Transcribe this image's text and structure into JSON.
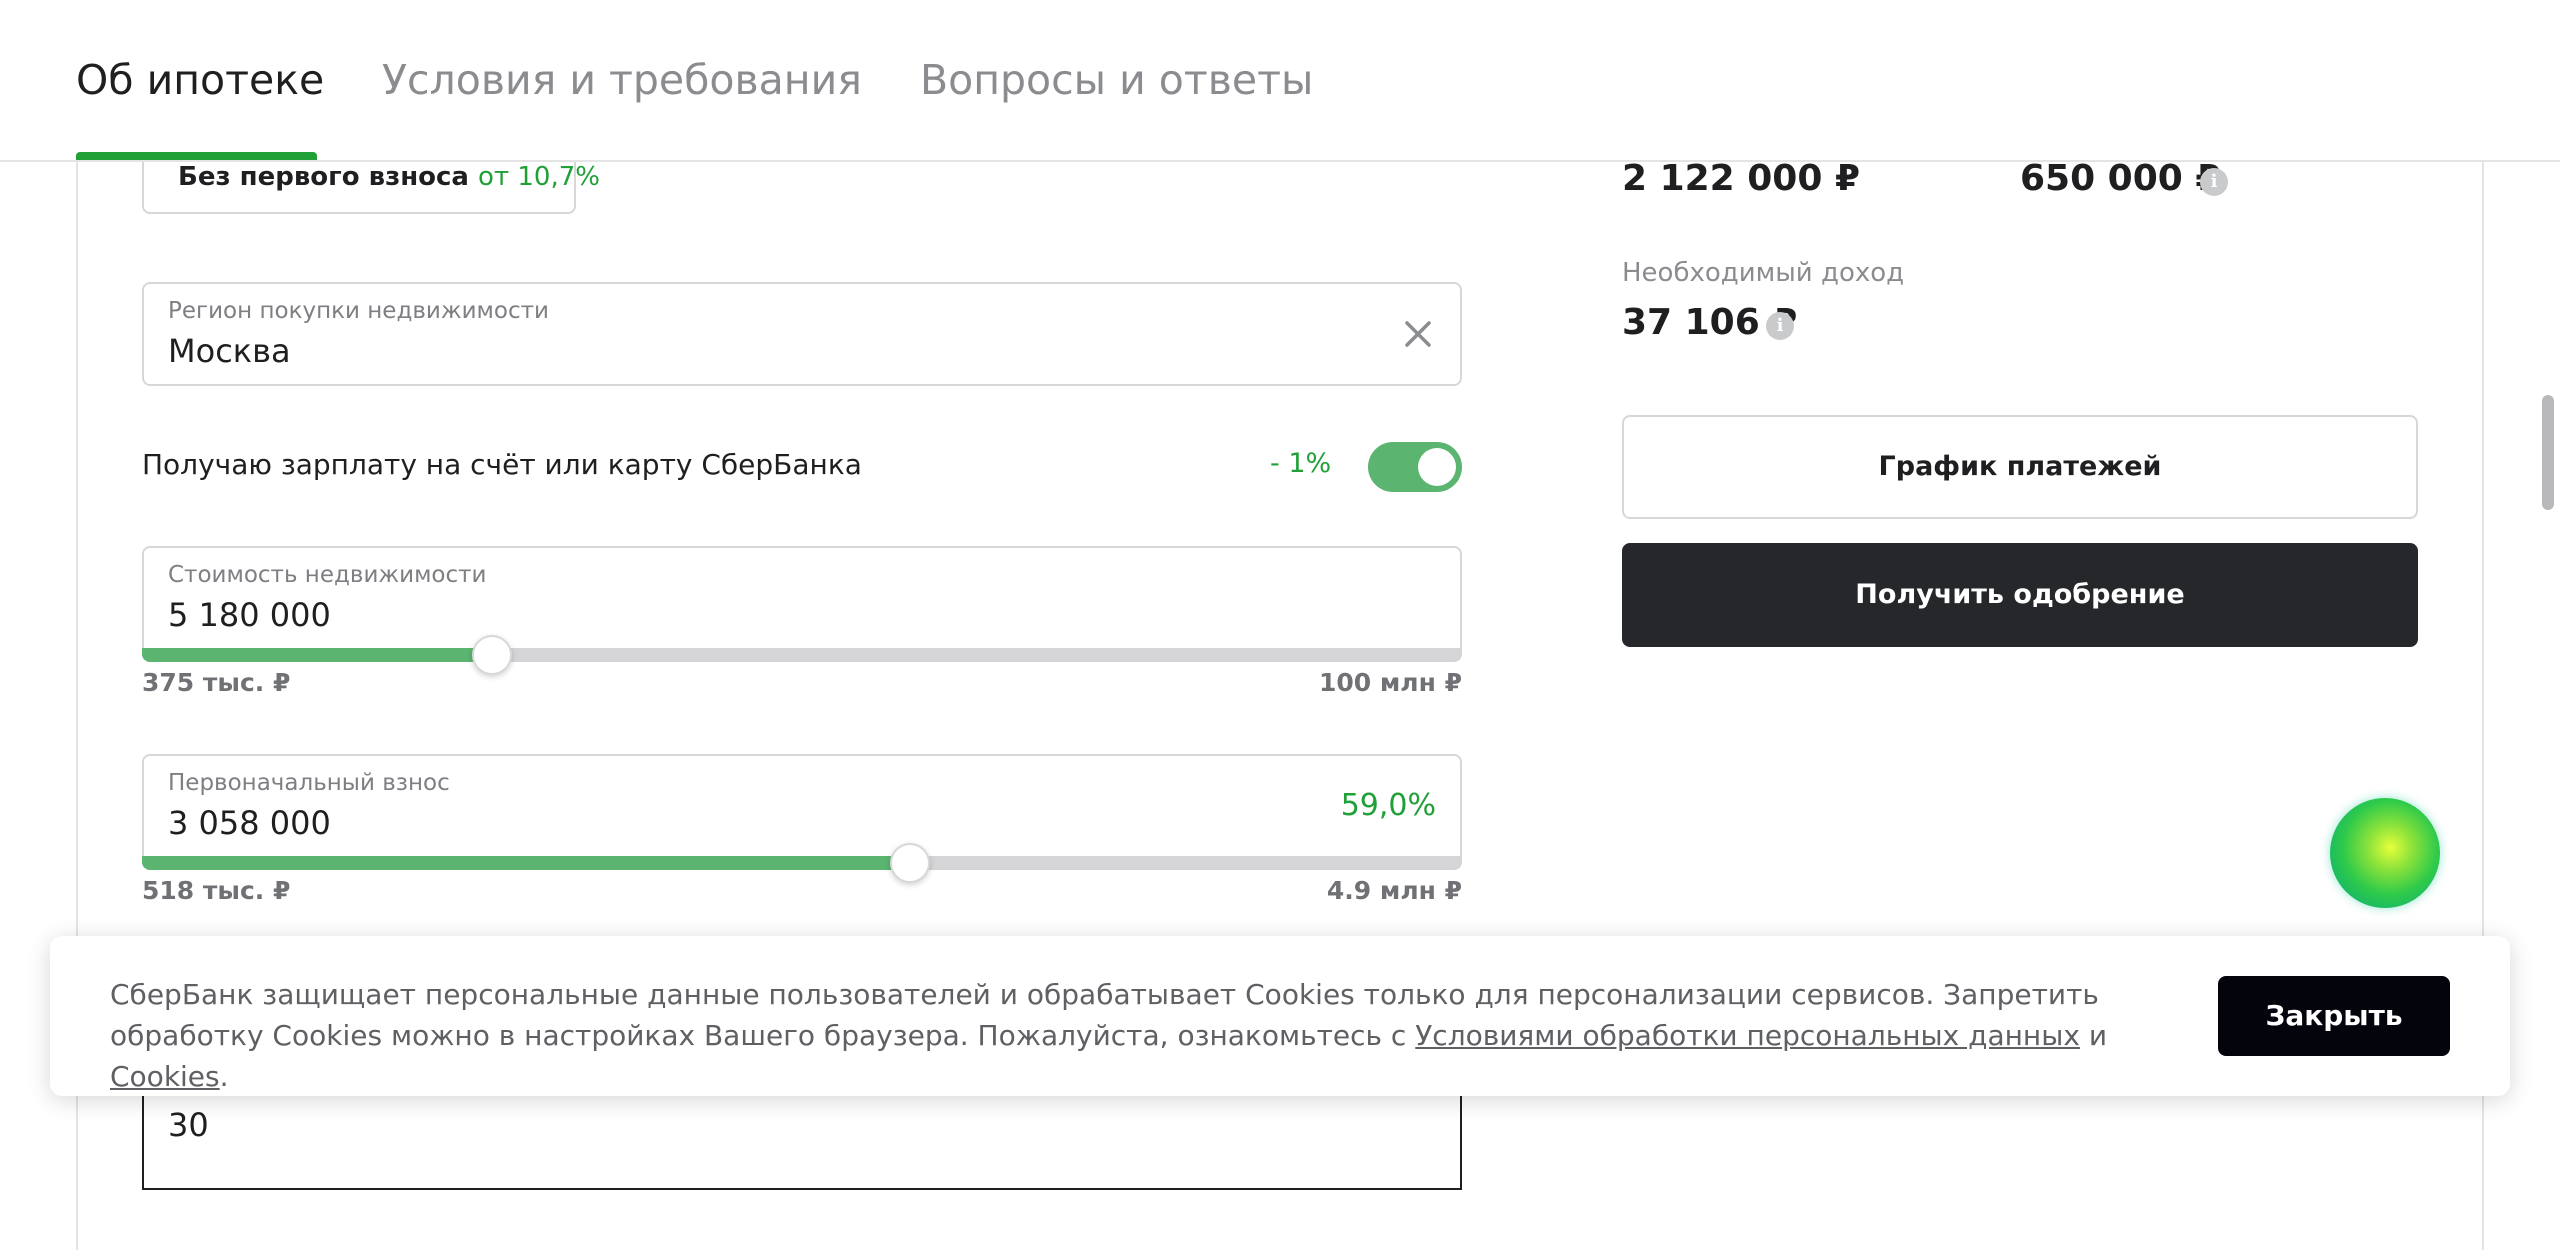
{
  "tabs": [
    {
      "label": "Об ипотеке",
      "active": true
    },
    {
      "label": "Условия и требования",
      "active": false
    },
    {
      "label": "Вопросы и ответы",
      "active": false
    }
  ],
  "program_chip": {
    "label": "Без первого взноса",
    "rate": "от 10,7%"
  },
  "region": {
    "label": "Регион покупки недвижимости",
    "value": "Москва"
  },
  "salary": {
    "label": "Получаю зарплату на счёт или карту СберБанка",
    "discount": "- 1%",
    "enabled": true
  },
  "property_cost": {
    "label": "Стоимость недвижимости",
    "value": "5 180 000",
    "min_label": "375 тыс. ₽",
    "max_label": "100 млн ₽",
    "slider_fraction": 0.265
  },
  "down_payment": {
    "label": "Первоначальный взнос",
    "value": "3 058 000",
    "percent": "59,0%",
    "min_label": "518 тыс. ₽",
    "max_label": "4.9 млн ₽",
    "slider_fraction": 0.582
  },
  "term": {
    "value": "30"
  },
  "results": {
    "value_1": "2 122 000 ₽",
    "value_2": "650 000 ₽",
    "income_label": "Необходимый доход",
    "income_value": "37 106 ₽"
  },
  "buttons": {
    "schedule": "График платежей",
    "approval": "Получить одобрение"
  },
  "cookie": {
    "text_1": "СберБанк защищает персональные данные пользователей и обрабатывает Cookies только для персонализации сервисов. Запретить обработку Cookies можно в настройках Вашего браузера. Пожалуйста, ознакомьтесь с ",
    "link_1": "Условиями обработки персональных данных",
    "text_2": " и ",
    "link_2": "Cookies",
    "text_3": ".",
    "close_label": "Закрыть"
  },
  "colors": {
    "accent": "#21a038",
    "slider_fill": "#5bb470",
    "dark_button": "#26272b",
    "cookie_button": "#04040c"
  }
}
